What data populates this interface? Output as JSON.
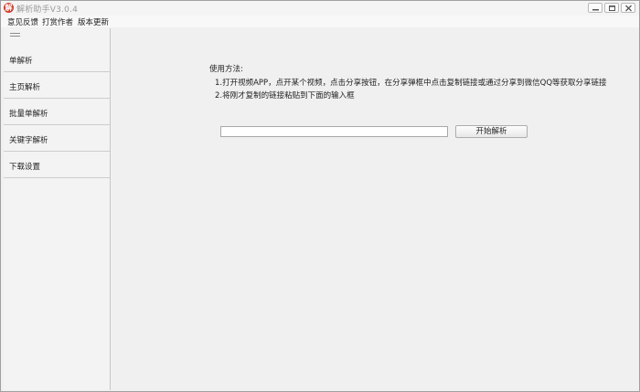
{
  "window": {
    "title": "解析助手V3.0.4",
    "app_icon_glyph": "解"
  },
  "menu": {
    "items": [
      {
        "label": "意见反馈"
      },
      {
        "label": "打赏作者"
      },
      {
        "label": "版本更新"
      }
    ]
  },
  "sidebar": {
    "items": [
      {
        "label": "单解析"
      },
      {
        "label": "主页解析"
      },
      {
        "label": "批量单解析"
      },
      {
        "label": "关键字解析"
      },
      {
        "label": "下载设置"
      }
    ]
  },
  "main": {
    "usage_title": "使用方法:",
    "steps": [
      "1.打开视频APP，点开某个视频，点击分享按钮，在分享弹框中点击复制链接或通过分享到微信QQ等获取分享链接",
      "2.将刚才复制的链接粘贴到下面的输入框"
    ],
    "url_input": {
      "value": "",
      "placeholder": ""
    },
    "start_button_label": "开始解析"
  },
  "colors": {
    "app_icon": "#d23a2c",
    "background": "#f0f0f0",
    "title_text": "#9a9a9a"
  },
  "icons": {
    "app": "app-logo-icon",
    "minimize": "minimize-icon",
    "maximize": "maximize-icon",
    "close": "close-icon",
    "menu": "hamburger-menu-icon"
  }
}
